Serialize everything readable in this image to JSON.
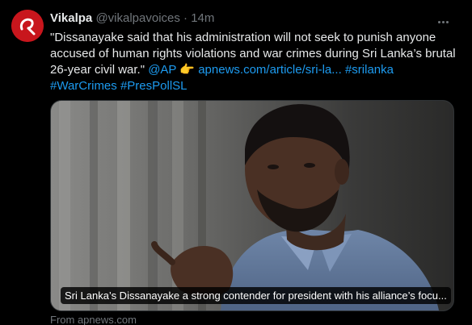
{
  "tweet": {
    "author_name": "Vikalpa",
    "author_handle": "@vikalpavoices",
    "separator": "·",
    "time": "14m",
    "text_main": "\"Dissanayake said that his administration will not seek to punish anyone accused of human rights violations and war crimes during Sri Lanka’s brutal 26-year civil war.\"",
    "mention": "@AP",
    "pointer_emoji": "👉",
    "link_text": "apnews.com/article/sri-la...",
    "hashtag_1": "#srilanka",
    "hashtag_2": "#WarCrimes",
    "hashtag_3": "#PresPollSL"
  },
  "card": {
    "caption": "Sri Lanka’s Dissanayake a strong contender for president with his alliance’s focu...",
    "source": "From apnews.com"
  },
  "colors": {
    "background": "#000000",
    "text": "#e7e9ea",
    "muted": "#71767b",
    "link": "#1d9bf0",
    "avatar_brand": "#c8161d"
  },
  "icons": {
    "more": "more-horizontal-icon",
    "avatar": "vikalpa-logo"
  }
}
